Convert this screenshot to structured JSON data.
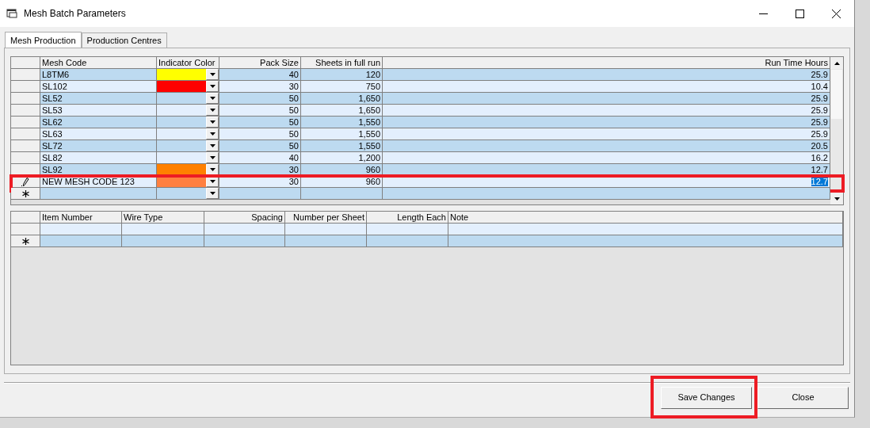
{
  "window": {
    "title": "Mesh Batch Parameters"
  },
  "tabs": [
    {
      "label": "Mesh Production",
      "selected": true
    },
    {
      "label": "Production Centres",
      "selected": false
    }
  ],
  "mesh_grid": {
    "columns": [
      "Mesh Code",
      "Indicator Color",
      "Pack Size",
      "Sheets in full run",
      "Run Time Hours"
    ],
    "rows": [
      {
        "kind": "data",
        "selected": false,
        "mesh_code": "L8TM6",
        "color": "#ffff00",
        "pack_size": "40",
        "sheets": "120",
        "run_time": "25.9"
      },
      {
        "kind": "data",
        "selected": false,
        "mesh_code": "SL102",
        "color": "#ff0000",
        "pack_size": "30",
        "sheets": "750",
        "run_time": "10.4"
      },
      {
        "kind": "data",
        "selected": false,
        "mesh_code": "SL52",
        "pack_size": "50",
        "sheets": "1,650",
        "run_time": "25.9"
      },
      {
        "kind": "data",
        "selected": false,
        "mesh_code": "SL53",
        "pack_size": "50",
        "sheets": "1,650",
        "run_time": "25.9"
      },
      {
        "kind": "data",
        "selected": false,
        "mesh_code": "SL62",
        "pack_size": "50",
        "sheets": "1,550",
        "run_time": "25.9"
      },
      {
        "kind": "data",
        "selected": false,
        "mesh_code": "SL63",
        "pack_size": "50",
        "sheets": "1,550",
        "run_time": "25.9"
      },
      {
        "kind": "data",
        "selected": false,
        "mesh_code": "SL72",
        "pack_size": "50",
        "sheets": "1,550",
        "run_time": "20.5"
      },
      {
        "kind": "data",
        "selected": false,
        "mesh_code": "SL82",
        "pack_size": "40",
        "sheets": "1,200",
        "run_time": "16.2"
      },
      {
        "kind": "data",
        "selected": false,
        "mesh_code": "SL92",
        "color": "#ff8000",
        "pack_size": "30",
        "sheets": "960",
        "run_time": "12.7"
      },
      {
        "kind": "editing",
        "selected": true,
        "mesh_code": "NEW MESH CODE 123",
        "color": "#ff8040",
        "pack_size": "30",
        "sheets": "960",
        "run_time": "12.7"
      },
      {
        "kind": "new",
        "selected": false
      }
    ]
  },
  "items_grid": {
    "columns": [
      "Item Number",
      "Wire Type",
      "Spacing",
      "Number per Sheet",
      "Length Each",
      "Note"
    ],
    "rows": [
      {
        "kind": "data"
      },
      {
        "kind": "new"
      }
    ]
  },
  "buttons": [
    {
      "label": "Save Changes",
      "highlighted": true
    },
    {
      "label": "Close",
      "highlighted": false
    }
  ]
}
